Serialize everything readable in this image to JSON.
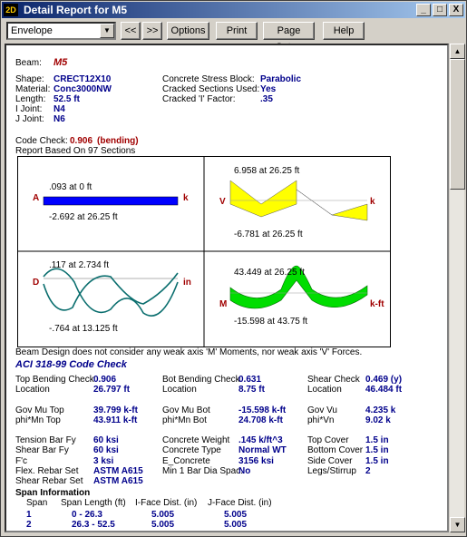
{
  "window": {
    "title": "Detail Report for M5",
    "app_icon": "2D",
    "minimize": "_",
    "maximize": "□",
    "close": "X"
  },
  "toolbar": {
    "combo_value": "Envelope",
    "prev_label": "<<",
    "next_label": ">>",
    "options_label": "Options",
    "print_label": "Print",
    "page_setup_label": "Page Setup",
    "help_label": "Help"
  },
  "member": {
    "beam_label": "Beam:",
    "beam_value": "M5",
    "shape_label": "Shape:",
    "shape_value": "CRECT12X10",
    "material_label": "Material:",
    "material_value": "Conc3000NW",
    "length_label": "Length:",
    "length_value": "52.5 ft",
    "ijoint_label": "I Joint:",
    "ijoint_value": "N4",
    "jjoint_label": "J Joint:",
    "jjoint_value": "N6",
    "stress_block_label": "Concrete Stress Block:",
    "stress_block_value": "Parabolic",
    "cracked_label": "Cracked Sections Used:",
    "cracked_value": "Yes",
    "cracked_factor_label": "Cracked 'I' Factor:",
    "cracked_factor_value": ".35"
  },
  "code_check": {
    "label": "Code Check:",
    "value": "0.906",
    "type": "(bending)",
    "sections": "Report Based On 97 Sections"
  },
  "diagrams": {
    "axial": {
      "symbol": "A",
      "unit": "k",
      "max": ".093 at 0 ft",
      "min": "-2.692 at 26.25 ft",
      "color": "#0000ff"
    },
    "shear": {
      "symbol": "V",
      "unit": "k",
      "max": "6.958 at 26.25 ft",
      "min": "-6.781 at 26.25 ft",
      "color": "#ffff00"
    },
    "deflection": {
      "symbol": "D",
      "unit": "in",
      "max": ".117 at 2.734 ft",
      "min": "-.764 at 13.125 ft",
      "color": "#0a6e6e"
    },
    "moment": {
      "symbol": "M",
      "unit": "k-ft",
      "max": "43.449 at 26.25 ft",
      "min": "-15.598 at 43.75 ft",
      "color": "#00dd00"
    }
  },
  "note": "Beam Design does not consider any weak axis 'M' Moments, nor weak axis 'V' Forces.",
  "aci": {
    "title": "ACI 318-99 Code Check",
    "col1": [
      [
        "Top Bending Check",
        "0.906"
      ],
      [
        "Location",
        "26.797 ft"
      ],
      [
        "",
        ""
      ],
      [
        "Gov Mu Top",
        "39.799 k-ft"
      ],
      [
        "phi*Mn Top",
        "43.911 k-ft"
      ],
      [
        "",
        ""
      ],
      [
        "Tension Bar Fy",
        "60 ksi"
      ],
      [
        "Shear Bar Fy",
        "60 ksi"
      ],
      [
        "F'c",
        "3 ksi"
      ],
      [
        "Flex. Rebar Set",
        "ASTM A615"
      ],
      [
        "Shear Rebar Set",
        "ASTM A615"
      ]
    ],
    "col2": [
      [
        "Bot Bending Check",
        "0.631"
      ],
      [
        "Location",
        "8.75 ft"
      ],
      [
        "",
        ""
      ],
      [
        "Gov Mu Bot",
        "-15.598 k-ft"
      ],
      [
        "phi*Mn Bot",
        "24.708 k-ft"
      ],
      [
        "",
        ""
      ],
      [
        "Concrete Weight",
        ".145 k/ft^3"
      ],
      [
        "Concrete Type",
        "Normal WT"
      ],
      [
        "E_Concrete",
        "3156 ksi"
      ],
      [
        "Min 1 Bar Dia Spac.",
        "No"
      ]
    ],
    "col3": [
      [
        "Shear Check",
        "0.469 (y)"
      ],
      [
        "Location",
        "46.484 ft"
      ],
      [
        "",
        ""
      ],
      [
        "Gov Vu",
        "4.235 k"
      ],
      [
        "phi*Vn",
        "9.02 k"
      ],
      [
        "",
        ""
      ],
      [
        "Top Cover",
        "1.5 in"
      ],
      [
        "Bottom Cover",
        "1.5 in"
      ],
      [
        "Side Cover",
        "1.5 in"
      ],
      [
        "Legs/Stirrup",
        "2"
      ]
    ]
  },
  "span_info": {
    "title": "Span Information",
    "headers": [
      "Span",
      "Span Length (ft)",
      "I-Face Dist. (in)",
      "J-Face Dist. (in)"
    ],
    "rows": [
      [
        "1",
        "0 - 26.3",
        "5.005",
        "5.005"
      ],
      [
        "2",
        "26.3 - 52.5",
        "5.005",
        "5.005"
      ]
    ]
  }
}
